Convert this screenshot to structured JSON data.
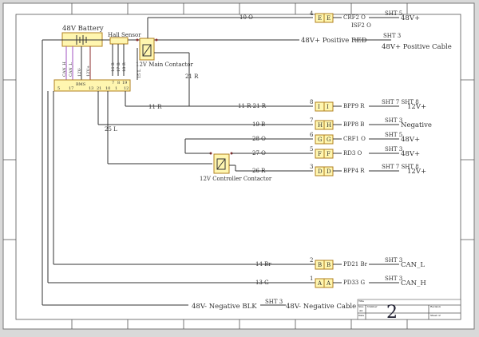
{
  "battery": {
    "label": "48V Battery"
  },
  "hall_sensor": {
    "label": "Hall Sensor",
    "pins": [
      "16 B",
      "17 B",
      "18 R"
    ]
  },
  "main_contactor": {
    "label": "12V Main Contactor",
    "wire_in": "15 L",
    "wire_out": "21 R"
  },
  "bms": {
    "label": "BMS",
    "pins_bottom": [
      "5",
      "17",
      "13",
      "21",
      "10",
      "1",
      "12"
    ],
    "pins_top": [
      "7",
      "8",
      "19"
    ],
    "wires": [
      "CAN_H",
      "CAN_L",
      "12V-",
      "12V+"
    ],
    "wire_25": "25 L"
  },
  "positive_bus": {
    "label": "48V+ Positive RED",
    "sht": "SHT 3",
    "dest": "48V+ Positive Cable"
  },
  "negative_bus": {
    "label": "48V- Negative BLK",
    "sht": "SHT 3",
    "dest": "48V- Negative Cable"
  },
  "controller_contactor": {
    "label": "12V Controller Contactor"
  },
  "connectors": [
    {
      "num": "4",
      "letter": "E",
      "wire": "10 O",
      "right": "CRF2 O",
      "right2": "ISF2 O",
      "sht": "SHT 5",
      "dest": "48V+"
    },
    {
      "num": "8",
      "letter": "I",
      "wire": "11 R  21 R",
      "wire_left": "11 R",
      "right": "BPP9 R",
      "sht": "SHT 7 SHT 8",
      "dest": "12V+"
    },
    {
      "num": "7",
      "letter": "H",
      "wire": "19 B",
      "right": "BPP8 B",
      "sht": "SHT 3",
      "dest": "Negative"
    },
    {
      "num": "6",
      "letter": "G",
      "wire": "28 O",
      "right": "CRF1 O",
      "sht": "SHT 5",
      "dest": "48V+"
    },
    {
      "num": "5",
      "letter": "F",
      "wire": "27 O",
      "right": "RD3 O",
      "sht": "SHT 3",
      "dest": "48V+"
    },
    {
      "num": "3",
      "letter": "D",
      "wire": "26 R",
      "right": "BPP4 R",
      "sht": "SHT 7 SHT 8",
      "dest": "12V+"
    },
    {
      "num": "2",
      "letter": "B",
      "wire": "14 Br",
      "right": "PD21 Br",
      "sht": "SHT 3",
      "dest": "CAN_L"
    },
    {
      "num": "1",
      "letter": "A",
      "wire": "13 G",
      "right": "PD33 G",
      "sht": "SHT 3",
      "dest": "CAN_H"
    }
  ],
  "title_block": {
    "sheet_number": "2",
    "title_label": "Title",
    "size_label": "Size",
    "size": "A4",
    "number_label": "Number",
    "revision_label": "Revision",
    "date_label": "Date",
    "sheet_label": "Sheet of"
  },
  "colors": {
    "connector_fill": "#fff6b0",
    "connector_stroke": "#b08020",
    "wire_red": "#8b2b2b",
    "wire_purple": "#a050c0"
  }
}
